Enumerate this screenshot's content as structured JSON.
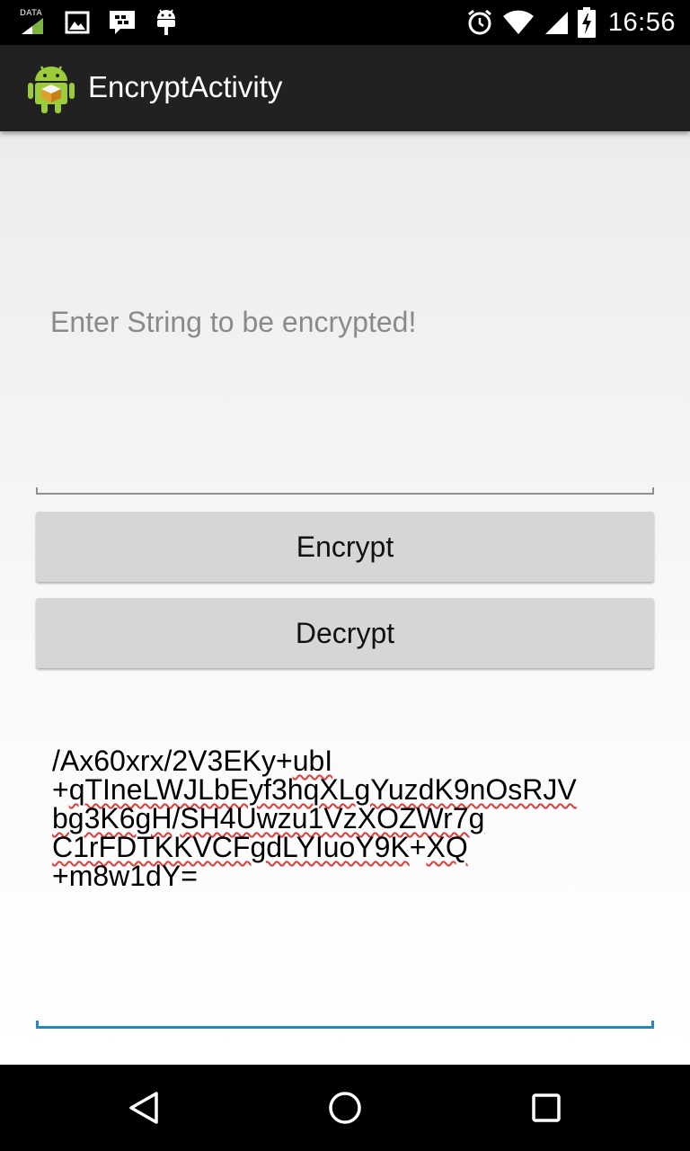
{
  "status_bar": {
    "data_label": "DATA",
    "time": "16:56",
    "icons": [
      "data-signal-icon",
      "image-icon",
      "bbm-icon",
      "android-icon",
      "alarm-icon",
      "wifi-icon",
      "cell-signal-icon",
      "battery-charging-icon"
    ]
  },
  "action_bar": {
    "app_icon": "android-app-icon",
    "title": "EncryptActivity"
  },
  "input": {
    "value": "",
    "placeholder": "Enter String to be encrypted!"
  },
  "buttons": {
    "encrypt_label": "Encrypt",
    "decrypt_label": "Decrypt"
  },
  "output": {
    "text": "/Ax60xrx/2V3EKy+ubI+qTIneLWJLbEyf3hqXLgYuzdK9nOsRJVbg3K6gH/SH4Uwzu1VzXOZWr7gC1rFDTKKVCFgdLYIuoY9K+XQ+m8w1dY=",
    "lines": [
      {
        "plain_pre": "/Ax60xrx/2V3EKy+",
        "underlined": "ubI",
        "plain_post": ""
      },
      {
        "plain_pre": "+",
        "underlined": "qTIneLWJLbEyf3hqXLgYuzdK9nOsRJV",
        "plain_post": ""
      },
      {
        "plain_pre": "",
        "underlined": "bg3K6gH",
        "plain_mid": "/",
        "underlined2": "SH4Uwzu1VzXOZWr7g",
        "plain_post": ""
      },
      {
        "plain_pre": "",
        "underlined": "C1rFDTKKVCFgdLYIuoY9K",
        "plain_mid": "+",
        "underlined2": "XQ",
        "plain_post": ""
      },
      {
        "plain_pre": "+m8w1dY=",
        "underlined": "",
        "plain_post": ""
      }
    ]
  },
  "nav_bar": {
    "back_icon": "back-triangle-icon",
    "home_icon": "home-circle-icon",
    "recents_icon": "recents-square-icon"
  },
  "colors": {
    "action_bar": "#212121",
    "button_bg": "#d6d6d6",
    "focus_underline": "#1e88c8",
    "spell_error": "#e53935"
  }
}
